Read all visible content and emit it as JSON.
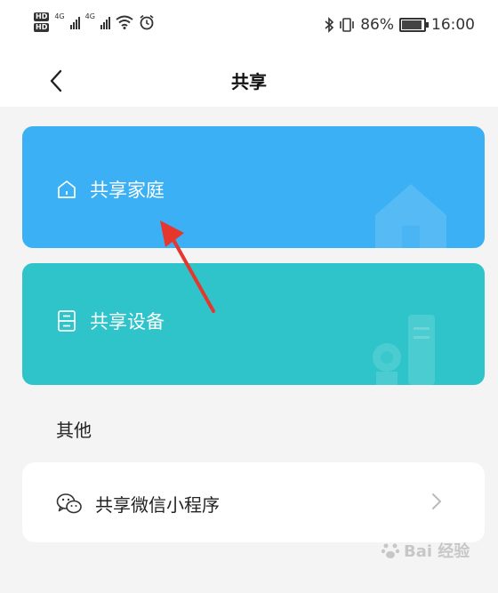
{
  "status_bar": {
    "network_badges": [
      "HD",
      "HD"
    ],
    "signal_labels": [
      "4G",
      "4G"
    ],
    "battery_percent": "86%",
    "battery_level": 0.86,
    "time": "16:00"
  },
  "navbar": {
    "title": "共享"
  },
  "cards": [
    {
      "label": "共享家庭",
      "color": "#3bb0f4",
      "icon": "home-icon"
    },
    {
      "label": "共享设备",
      "color": "#2ec4c9",
      "icon": "device-icon"
    }
  ],
  "section": {
    "title": "其他"
  },
  "wechat": {
    "label": "共享微信小程序",
    "icon": "wechat-icon"
  },
  "watermark": {
    "text": "Bai 经验"
  }
}
